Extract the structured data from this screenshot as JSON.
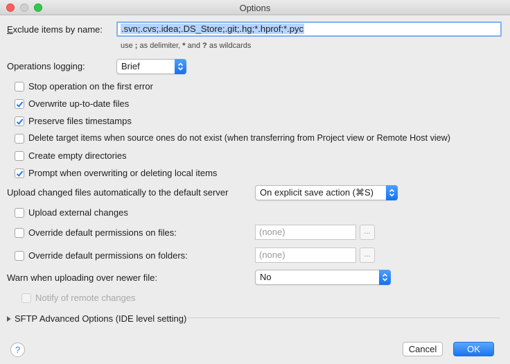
{
  "window": {
    "title": "Options"
  },
  "exclude": {
    "label_first": "E",
    "label_rest": "xclude items by name:",
    "value": ".svn;.cvs;.idea;.DS_Store;.git;.hg;*.hprof;*.pyc",
    "hint_pre": "use ",
    "hint_sc": ";",
    "hint_mid": " as delimiter, ",
    "hint_star": "*",
    "hint_and": " and ",
    "hint_q": "?",
    "hint_post": " as wildcards"
  },
  "logging": {
    "label": "Operations logging:",
    "value": "Brief"
  },
  "checkboxes": [
    {
      "label": "Stop operation on the first error",
      "checked": false
    },
    {
      "label": "Overwrite up-to-date files",
      "checked": true
    },
    {
      "label": "Preserve files timestamps",
      "checked": true
    },
    {
      "label": "Delete target items when source ones do not exist (when transferring from Project view or Remote Host view)",
      "checked": false
    },
    {
      "label": "Create empty directories",
      "checked": false
    },
    {
      "label": "Prompt when overwriting or deleting local items",
      "checked": true
    }
  ],
  "upload": {
    "label": "Upload changed files automatically to the default server",
    "value": "On explicit save action (⌘S)",
    "external_label": "Upload external changes",
    "external_checked": false
  },
  "permissions": {
    "files_label": "Override default permissions on files:",
    "files_value": "(none)",
    "folders_label": "Override default permissions on folders:",
    "folders_value": "(none)",
    "dots": "..."
  },
  "warn": {
    "label": "Warn when uploading over newer file:",
    "value": "No",
    "notify_label": "Notify of remote changes"
  },
  "sftp": {
    "label": "SFTP Advanced Options (IDE level setting)"
  },
  "buttons": {
    "help": "?",
    "cancel": "Cancel",
    "ok": "OK"
  },
  "colors": {
    "accent": "#1b74f0",
    "selection": "#b5d5ff"
  }
}
